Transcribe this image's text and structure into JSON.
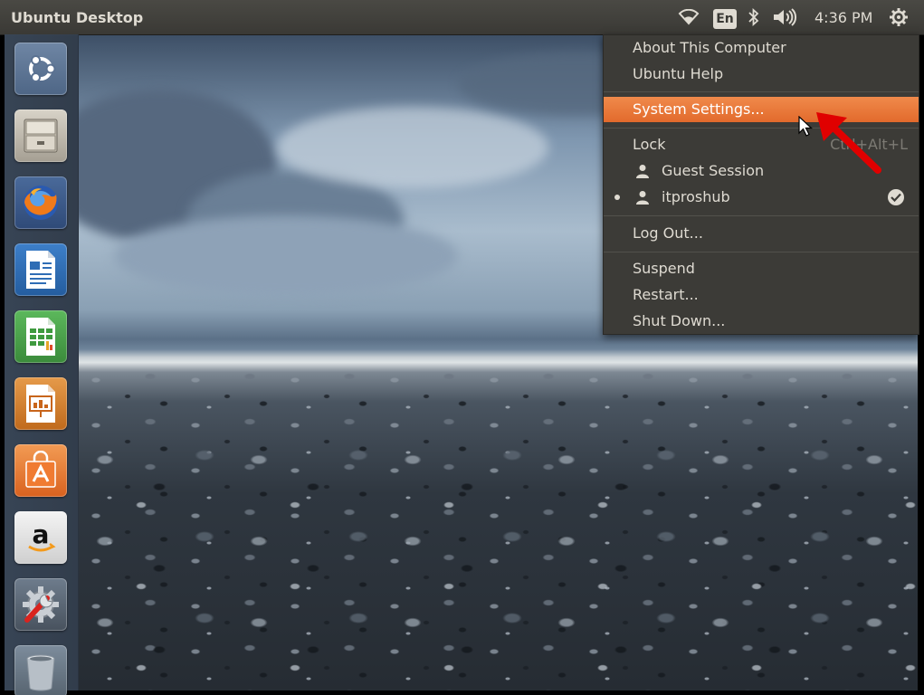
{
  "top_panel": {
    "title": "Ubuntu Desktop",
    "keyboard_layout": "En",
    "clock": "4:36 PM"
  },
  "launcher": {
    "items": [
      "ubuntu-dash",
      "files",
      "firefox",
      "libreoffice-writer",
      "libreoffice-calc",
      "libreoffice-impress",
      "ubuntu-software-center",
      "amazon",
      "system-settings",
      "trash"
    ]
  },
  "menu": {
    "about": "About This Computer",
    "help": "Ubuntu Help",
    "settings": "System Settings...",
    "lock": "Lock",
    "lock_shortcut": "Ctrl+Alt+L",
    "guest": "Guest Session",
    "user": "itproshub",
    "logout": "Log Out...",
    "suspend": "Suspend",
    "restart": "Restart...",
    "shutdown": "Shut Down..."
  },
  "colors": {
    "panel": "#3a3935",
    "highlight": "#e26a2c",
    "annotation_arrow": "#e00000"
  }
}
